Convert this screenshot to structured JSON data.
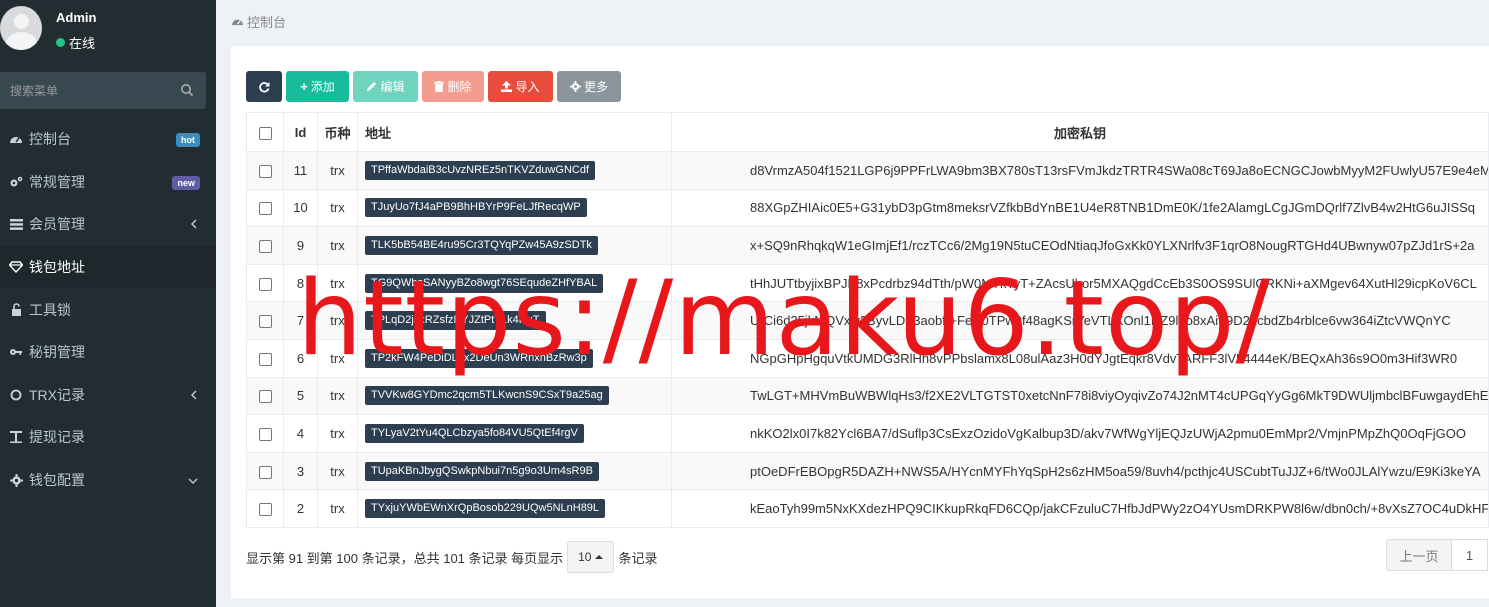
{
  "user": {
    "name": "Admin",
    "status": "在线",
    "status_color": "#26c281"
  },
  "sidebar": {
    "search_placeholder": "搜索菜单",
    "items": [
      {
        "label": "控制台",
        "icon": "dashboard-icon",
        "badge": "hot",
        "badge_color": "#3c8dbc"
      },
      {
        "label": "常规管理",
        "icon": "cogs-icon",
        "badge": "new",
        "badge_color": "#605ca8"
      },
      {
        "label": "会员管理",
        "icon": "list-icon",
        "chevron": "left"
      },
      {
        "label": "钱包地址",
        "icon": "diamond-icon",
        "active": true
      },
      {
        "label": "工具锁",
        "icon": "lock-icon"
      },
      {
        "label": "秘钥管理",
        "icon": "key-icon"
      },
      {
        "label": "TRX记录",
        "icon": "circle-icon",
        "chevron": "left"
      },
      {
        "label": "提现记录",
        "icon": "text-icon"
      },
      {
        "label": "钱包配置",
        "icon": "gear-icon",
        "chevron": "down"
      }
    ]
  },
  "breadcrumb": {
    "label": "控制台"
  },
  "toolbar": {
    "add": "添加",
    "edit": "编辑",
    "delete": "删除",
    "import": "导入",
    "more": "更多"
  },
  "table": {
    "headers": {
      "id": "Id",
      "coin": "币种",
      "address": "地址",
      "key": "加密私钥"
    },
    "rows": [
      {
        "id": "11",
        "coin": "trx",
        "address": "TPffaWbdaiB3cUvzNREz5nTKVZduwGNCdf",
        "key": "d8VrmzA504f1521LGP6j9PPFrLWA9bm3BX780sT13rsFVmJkdzTRTR4SWa08cT69Ja8oECNGCJowbMyyM2FUwlyU57E9e4eM"
      },
      {
        "id": "10",
        "coin": "trx",
        "address": "TJuyUo7fJ4aPB9BhHBYrP9FeLJfRecqWP",
        "key": "88XGpZHIAic0E5+G31ybD3pGtm8meksrVZfkbBdYnBE1U4eR8TNB1DmE0K/1fe2AlamgLCgJGmDQrlf7ZlvB4w2HtG6uJISSq"
      },
      {
        "id": "9",
        "coin": "trx",
        "address": "TLK5bB54BE4ru95Cr3TQYqPZw45A9zSDTk",
        "key": "x+SQ9nRhqkqW1eGImjEf1/rczTCc6/2Mg19N5tuCEOdNtiaqJfoGxKk0YLXNrlfv3F1qrO8NougRTGHd4UBwnyw07pZJd1rS+2a"
      },
      {
        "id": "8",
        "coin": "trx",
        "address": "TG9QWbsSANyyBZo8wgt76SEqudeZHfYBAL",
        "key": "tHhJUTtbyjixBPJP8xPcdrbz94dTth/pW0MTkTyT+ZAcsUhor5MXAQgdCcEb3S0OS9SUlGRKNi+aXMgev64XutHl29icpKoV6CL"
      },
      {
        "id": "7",
        "coin": "trx",
        "address": "TPLqD2jJkRZsfzRYJZtPtT1k4HuT",
        "key": "UrCi6d35jkMQVxw2ByvLDF3aobf/+FeR0TPw9f48agKSrYeVTLXOnl1NZ9loo8xAiF9D22cbdZb4rblce6vw364iZtcVWQnYC"
      },
      {
        "id": "6",
        "coin": "trx",
        "address": "TP2kFW4PeDiDLex2DeUn3WRnxhBzRw3p",
        "key": "NGpGHpHgquVtkUMDG3RlHh8vPPbslamx8L08ulAaz3H0dYJgtEqkr8VdvTARFF3lVL4444eK/BEQxAh36s9O0m3Hif3WR0"
      },
      {
        "id": "5",
        "coin": "trx",
        "address": "TVVKw8GYDmc2qcm5TLKwcnS9CSxT9a25ag",
        "key": "TwLGT+MHVmBuWBWlqHs3/f2XE2VLTGTST0xetcNnF78i8viyOyqivZo74J2nMT4cUPGqYyGg6MkT9DWUljmbclBFuwgaydEhE"
      },
      {
        "id": "4",
        "coin": "trx",
        "address": "TYLyaV2tYu4QLCbzya5fo84VU5QtEf4rgV",
        "key": "nkKO2lx0I7k82Ycl6BA7/dSuflp3CsExzOzidoVgKalbup3D/akv7WfWgYljEQJzUWjA2pmu0EmMpr2/VmjnPMpZhQ0OqFjGOO"
      },
      {
        "id": "3",
        "coin": "trx",
        "address": "TUpaKBnJbygQSwkpNbui7n5g9o3Um4sR9B",
        "key": "ptOeDFrEBOpgR5DAZH+NWS5A/HYcnMYFhYqSpH2s6zHM5oa59/8uvh4/pcthjc4USCubtTuJJZ+6/tWo0JLAlYwzu/E9Ki3keYA"
      },
      {
        "id": "2",
        "coin": "trx",
        "address": "TYxjuYWbEWnXrQpBosob229UQw5NLnH89L",
        "key": "kEaoTyh99m5NxKXdezHPQ9CIKkupRkqFD6CQp/jakCFzuluC7HfbJdPWy2zO4YUsmDRKPW8l6w/dbn0ch/+8vXsZ7OC4uDkHF"
      }
    ]
  },
  "pager": {
    "info": "显示第 91 到第 100 条记录，总共 101 条记录 每页显示",
    "page_size": "10",
    "suffix": "条记录",
    "prev": "上一页",
    "page_1": "1"
  },
  "watermark": {
    "text": "https://maku6.top/",
    "color": "#e8171b"
  }
}
